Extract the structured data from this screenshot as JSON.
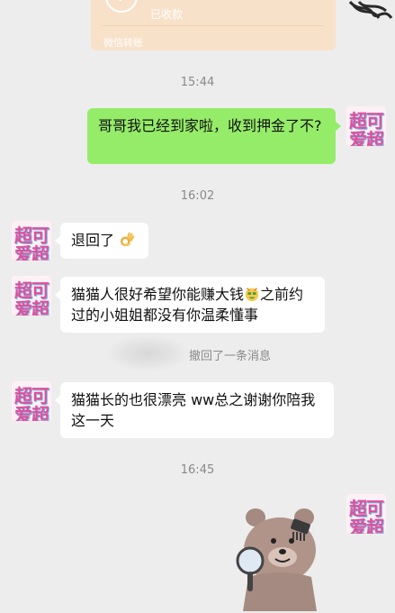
{
  "transfer": {
    "status": "已收款",
    "footer": "微信转账"
  },
  "messages": [
    {
      "kind": "time",
      "text": "15:44"
    },
    {
      "kind": "right",
      "text": "哥哥我已经到家啦，收到押金了不?"
    },
    {
      "kind": "time",
      "text": "16:02"
    },
    {
      "kind": "left",
      "text": "退回了",
      "emoji": "ok-hand-emoji"
    },
    {
      "kind": "left",
      "text_a": "猫猫人很好希望你能赚大钱",
      "emoji": "money-face-emoji",
      "text_b": "之前约过的小姐姐都没有你温柔懂事"
    },
    {
      "kind": "recall",
      "text": "撤回了一条消息"
    },
    {
      "kind": "left",
      "text": "猫猫长的也很漂亮 ww总之谢谢你陪我这一天"
    },
    {
      "kind": "time",
      "text": "16:45"
    }
  ],
  "sticker": {
    "icon": "bear-with-mirror-sticker"
  },
  "colors": {
    "background": "#ededed",
    "bubble_right": "#95ec69",
    "bubble_left": "#ffffff",
    "transfer_card": "#f8e1c9"
  }
}
